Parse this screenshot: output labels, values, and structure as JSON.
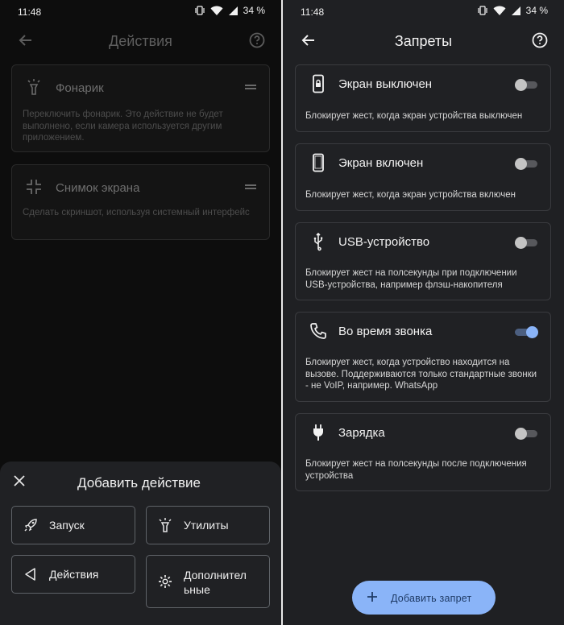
{
  "left_screen": {
    "status": {
      "time": "11:48",
      "battery": "34 %"
    },
    "title": "Действия",
    "cards": [
      {
        "title": "Фонарик",
        "description": "Переключить фонарик. Это действие не будет выполнено, если камера используется другим приложением.",
        "icon": "flashlight-icon"
      },
      {
        "title": "Снимок экрана",
        "description": "Сделать скриншот, используя системный интерфейс",
        "icon": "screenshot-icon"
      }
    ],
    "sheet": {
      "title": "Добавить действие",
      "buttons": [
        {
          "label": "Запуск",
          "icon": "rocket-icon"
        },
        {
          "label": "Утилиты",
          "icon": "flashlight-icon"
        },
        {
          "label": "Действия",
          "icon": "triangle-back-icon"
        },
        {
          "label": "Дополнительные",
          "icon": "gear-icon"
        }
      ]
    }
  },
  "right_screen": {
    "status": {
      "time": "11:48",
      "battery": "34 %"
    },
    "title": "Запреты",
    "cards": [
      {
        "title": "Экран выключен",
        "description": "Блокирует жест, когда экран устройства выключен",
        "enabled": false,
        "icon": "phone-lock-icon"
      },
      {
        "title": "Экран включен",
        "description": "Блокирует жест, когда экран устройства включен",
        "enabled": false,
        "icon": "phone-icon"
      },
      {
        "title": "USB-устройство",
        "description": "Блокирует жест на полсекунды при подключении USB-устройства, например флэш-накопителя",
        "enabled": false,
        "icon": "usb-icon"
      },
      {
        "title": "Во время звонка",
        "description": "Блокирует жест, когда устройство находится на вызове. Поддерживаются только стандартные звонки - не VoIP, например. WhatsApp",
        "enabled": true,
        "icon": "call-icon"
      },
      {
        "title": "Зарядка",
        "description": "Блокирует жест на полсекунды после подключения устройства",
        "enabled": false,
        "icon": "charger-plug-icon"
      }
    ],
    "fab_label": "Добавить запрет"
  },
  "colors": {
    "accent": "#8ab4f8",
    "card_bg": "#202124",
    "dim_bg": "#0d0d0d"
  }
}
